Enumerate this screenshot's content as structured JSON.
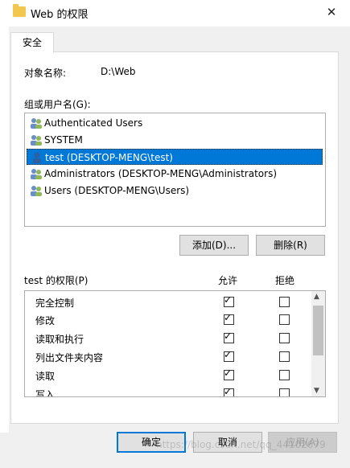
{
  "window": {
    "title": "Web 的权限",
    "close_glyph": "✕"
  },
  "tabs": [
    {
      "label": "安全"
    }
  ],
  "object": {
    "label": "对象名称:",
    "value": "D:\\Web"
  },
  "groups": {
    "label": "组或用户名(G):",
    "items": [
      {
        "label": "Authenticated Users",
        "selected": false
      },
      {
        "label": "SYSTEM",
        "selected": false
      },
      {
        "label": "test (DESKTOP-MENG\\test)",
        "selected": true
      },
      {
        "label": "Administrators (DESKTOP-MENG\\Administrators)",
        "selected": false
      },
      {
        "label": "Users (DESKTOP-MENG\\Users)",
        "selected": false
      }
    ]
  },
  "buttons": {
    "add": "添加(D)...",
    "remove": "删除(R)"
  },
  "permissions": {
    "title": "test 的权限(P)",
    "allow_header": "允许",
    "deny_header": "拒绝",
    "rows": [
      {
        "name": "完全控制",
        "allow": true,
        "deny": false
      },
      {
        "name": "修改",
        "allow": true,
        "deny": false
      },
      {
        "name": "读取和执行",
        "allow": true,
        "deny": false
      },
      {
        "name": "列出文件夹内容",
        "allow": true,
        "deny": false
      },
      {
        "name": "读取",
        "allow": true,
        "deny": false
      },
      {
        "name": "写入",
        "allow": true,
        "deny": false
      }
    ]
  },
  "footer": {
    "ok": "确定",
    "cancel": "取消",
    "apply": "应用(A)"
  },
  "watermark": "https://blog.csdn.net/qq_44102679",
  "colors": {
    "selection": "#0078d7",
    "folder": "#f3c64d"
  }
}
